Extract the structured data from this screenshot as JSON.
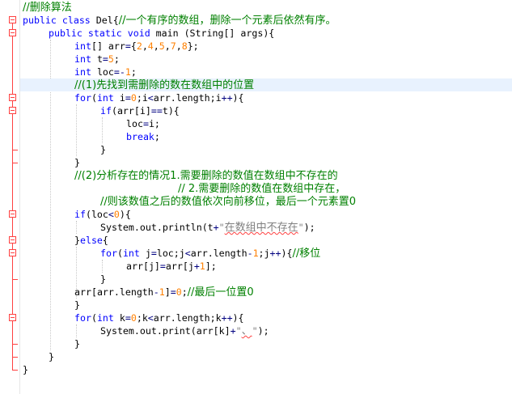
{
  "lines": [
    {
      "t": "//删除算法",
      "indent": 0
    },
    {
      "t": "public class Del{//一个有序的数组，删除一个元素后依然有序。",
      "indent": 0
    },
    {
      "t": "public static void main (String[] args){",
      "indent": 1
    },
    {
      "t": "int[] arr={2,4,5,7,8};",
      "indent": 2
    },
    {
      "t": "int t=5;",
      "indent": 2
    },
    {
      "t": "int loc=-1;",
      "indent": 2
    },
    {
      "t": "//(1)先找到需删除的数在数组中的位置",
      "indent": 2
    },
    {
      "t": "for(int i=0;i<arr.length;i++){",
      "indent": 2
    },
    {
      "t": "if(arr[i]==t){",
      "indent": 3
    },
    {
      "t": "loc=i;",
      "indent": 4
    },
    {
      "t": "break;",
      "indent": 4
    },
    {
      "t": "}",
      "indent": 3
    },
    {
      "t": "}",
      "indent": 2
    },
    {
      "t": "//(2)分析存在的情况1.需要删除的数值在数组中不存在的",
      "indent": 2
    },
    {
      "t": "// 2.需要删除的数值在数组中存在，",
      "indent": 6
    },
    {
      "t": "//则该数值之后的数值依次向前移位，最后一个元素置0",
      "indent": 3
    },
    {
      "t": "if(loc<0){",
      "indent": 2
    },
    {
      "t": "System.out.println(t+\"在数组中不存在\");",
      "indent": 3
    },
    {
      "t": "}else{",
      "indent": 2
    },
    {
      "t": "for(int j=loc;j<arr.length-1;j++){//移位",
      "indent": 3
    },
    {
      "t": "arr[j]=arr[j+1];",
      "indent": 4
    },
    {
      "t": "}",
      "indent": 3
    },
    {
      "t": "arr[arr.length-1]=0;//最后一位置0",
      "indent": 2
    },
    {
      "t": "}",
      "indent": 2
    },
    {
      "t": "for(int k=0;k<arr.length;k++){",
      "indent": 2
    },
    {
      "t": "System.out.print(arr[k]+\"、\");",
      "indent": 3
    },
    {
      "t": "}",
      "indent": 2
    },
    {
      "t": "}",
      "indent": 1
    },
    {
      "t": "}",
      "indent": 0
    }
  ],
  "highlighted_line": 6,
  "colors": {
    "keyword": "#0000ff",
    "number": "#ff8000",
    "string": "#808080",
    "comment": "#008000",
    "fold_marker": "#ff4040",
    "current_line": "#e8f2fe"
  }
}
